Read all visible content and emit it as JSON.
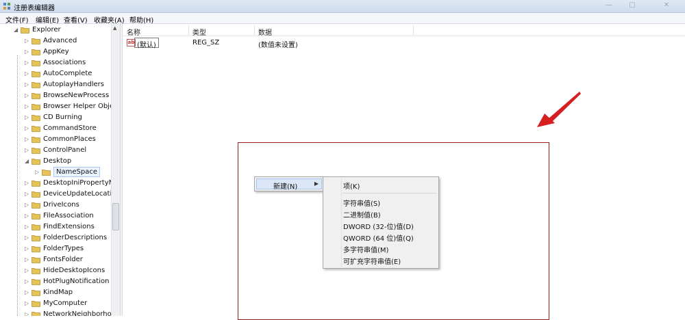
{
  "window": {
    "title": "注册表编辑器"
  },
  "menubar": {
    "items": [
      "文件(F)",
      "编辑(E)",
      "查看(V)",
      "收藏夹(A)",
      "帮助(H)"
    ]
  },
  "tree": {
    "root": "Explorer",
    "items": [
      "Advanced",
      "AppKey",
      "Associations",
      "AutoComplete",
      "AutoplayHandlers",
      "BrowseNewProcess",
      "Browser Helper Obje",
      "CD Burning",
      "CommandStore",
      "CommonPlaces",
      "ControlPanel",
      "Desktop",
      "NameSpace",
      "DesktopIniPropertyM",
      "DeviceUpdateLocatic",
      "DriveIcons",
      "FileAssociation",
      "FindExtensions",
      "FolderDescriptions",
      "FolderTypes",
      "FontsFolder",
      "HideDesktopIcons",
      "HotPlugNotification",
      "KindMap",
      "MyComputer",
      "NetworkNeighborho"
    ]
  },
  "list": {
    "columns": [
      "名称",
      "类型",
      "数据"
    ],
    "rows": [
      {
        "name": "(默认)",
        "type": "REG_SZ",
        "data": "(数值未设置)"
      }
    ]
  },
  "context_menu": {
    "new_label": "新建(N)",
    "submenu": [
      "项(K)",
      "字符串值(S)",
      "二进制值(B)",
      "DWORD (32-位)值(D)",
      "QWORD (64 位)值(Q)",
      "多字符串值(M)",
      "可扩充字符串值(E)"
    ]
  },
  "colors": {
    "highlight_box": "#9b1b1b",
    "arrow": "#d42020",
    "folder": "#e8c35a"
  }
}
